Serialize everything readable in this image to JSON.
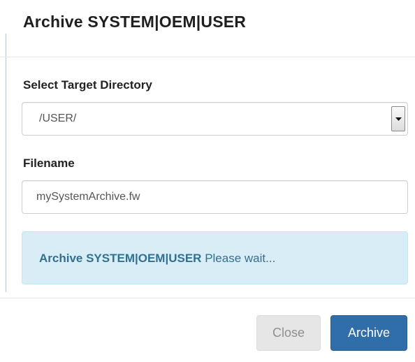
{
  "dialog": {
    "title": "Archive SYSTEM|OEM|USER"
  },
  "form": {
    "directory_label": "Select Target Directory",
    "directory_value": "/USER/",
    "filename_label": "Filename",
    "filename_value": "mySystemArchive.fw"
  },
  "alert": {
    "strong_text": "Archive SYSTEM|OEM|USER",
    "message": " Please wait...",
    "background": "#d9edf7",
    "text_color": "#31708f"
  },
  "footer": {
    "close_label": "Close",
    "archive_label": "Archive",
    "archive_color": "#2f6ea8"
  },
  "icons": {
    "select_arrow": "chevron-down-icon"
  }
}
